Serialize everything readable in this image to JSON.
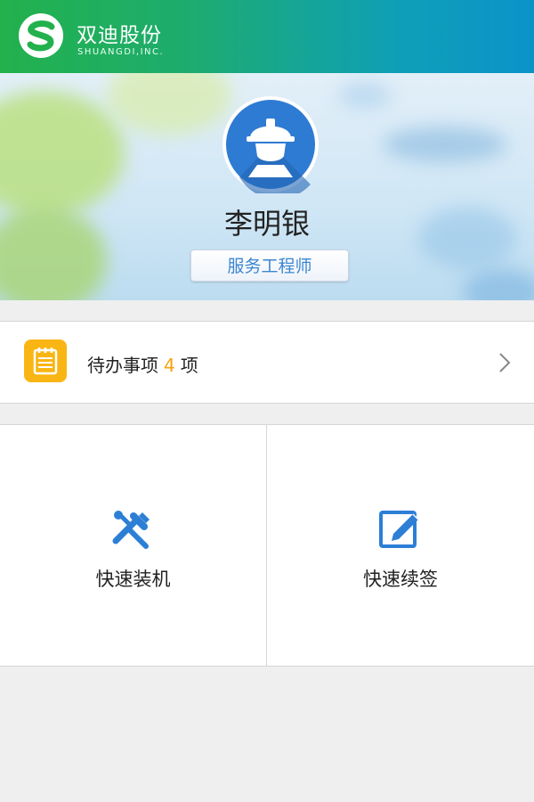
{
  "header": {
    "brand_cn": "双迪股份",
    "brand_en": "SHUANGDI,INC.",
    "logo_icon": "shuangdi-s-logo"
  },
  "profile": {
    "avatar_icon": "engineer-helmet-avatar-icon",
    "name": "李明银",
    "role": "服务工程师"
  },
  "todo": {
    "icon": "calendar-notepad-icon",
    "label": "待办事项",
    "count": "4",
    "unit": "项",
    "chevron_icon": "chevron-right-icon"
  },
  "quick_actions": [
    {
      "label": "快速装机",
      "icon": "tools-wrench-hammer-icon"
    },
    {
      "label": "快速续签",
      "icon": "edit-pencil-icon"
    }
  ],
  "colors": {
    "header_start": "#22b14c",
    "header_end": "#0b93c9",
    "accent_blue": "#2d7fd6",
    "todo_orange": "#f9b514",
    "count_orange": "#f9a10f"
  }
}
